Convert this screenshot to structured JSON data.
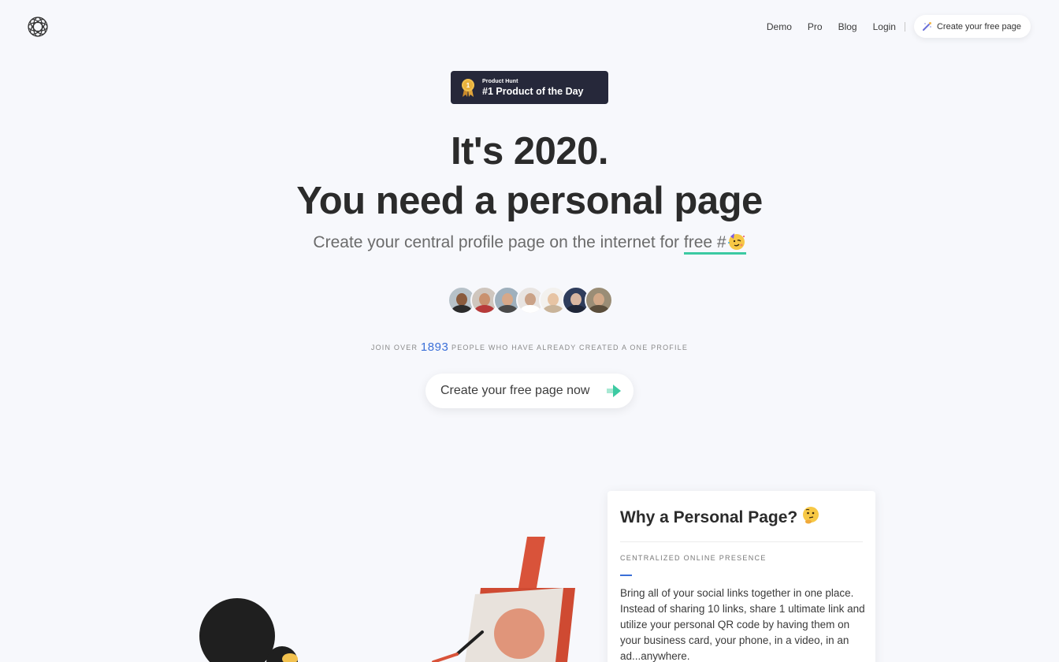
{
  "header": {
    "logo_icon": "knot-logo-icon",
    "nav": [
      "Demo",
      "Pro",
      "Blog",
      "Login"
    ],
    "cta_label": "Create your free page",
    "cta_icon": "magic-wand-icon"
  },
  "badge": {
    "small_label": "Product Hunt",
    "main_label": "#1 Product of the Day",
    "medal_number": "1",
    "icon": "medal-icon",
    "background": "#26283a"
  },
  "hero": {
    "title_line1": "It's 2020.",
    "title_line2": "You need a personal page",
    "subtitle_prefix": "Create your central profile page on the internet for ",
    "subtitle_link": "free #",
    "party_icon": "partying-face-icon",
    "accent_underline": "#3ccaa2"
  },
  "social_proof": {
    "avatar_count": 7,
    "join_prefix": "Join over",
    "count": "1893",
    "join_suffix": "people who have already created a one profile",
    "count_color": "#3a6fd8"
  },
  "cta": {
    "label": "Create your free page now",
    "icon": "arrow-right-icon"
  },
  "card": {
    "title": "Why a Personal Page?",
    "title_icon": "thinking-face-icon",
    "section_label": "CENTRALIZED ONLINE PRESENCE",
    "body": "Bring all of your social links together in one place. Instead of sharing 10 links, share 1 ultimate link and utilize your personal QR code by having them on your business card, your phone, in a video, in an ad...anywhere."
  }
}
